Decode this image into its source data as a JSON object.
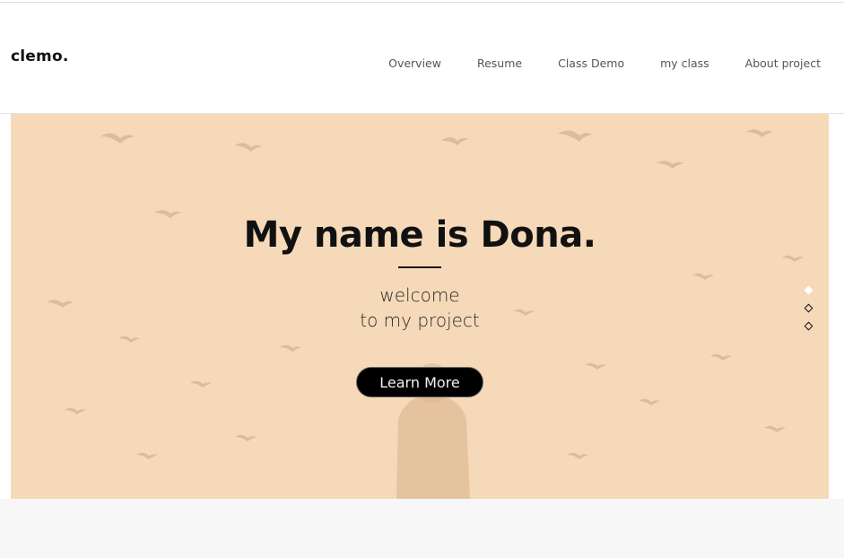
{
  "brand": {
    "logo": "clemo."
  },
  "nav": {
    "items": [
      {
        "label": "Overview"
      },
      {
        "label": "Resume"
      },
      {
        "label": "Class Demo"
      },
      {
        "label": "my class"
      },
      {
        "label": "About project"
      }
    ]
  },
  "hero": {
    "title": "My name is Dona.",
    "subtitle_line1": "welcome",
    "subtitle_line2": "to my project",
    "cta_label": "Learn More",
    "background_color": "#f6d9b8",
    "slides": {
      "count": 3,
      "active_index": 0
    }
  },
  "colors": {
    "accent": "#000000",
    "text": "#111111",
    "nav_text": "#555555",
    "footer_bg": "#f7f7f7"
  }
}
